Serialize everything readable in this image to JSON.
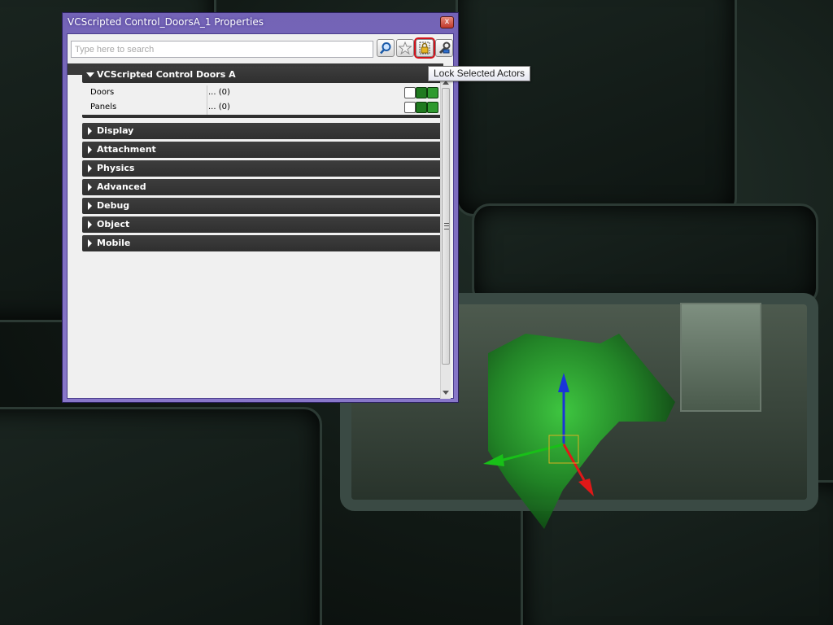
{
  "window": {
    "title": "VCScripted Control_DoorsA_1 Properties",
    "close_label": "x"
  },
  "toolbar": {
    "search_placeholder": "Type here to search",
    "buttons": [
      {
        "name": "search-button",
        "icon": "magnifier-icon"
      },
      {
        "name": "favorites-button",
        "icon": "star-icon"
      },
      {
        "name": "lock-selected-actors-button",
        "icon": "lock-icon",
        "highlighted": true
      },
      {
        "name": "tools-button",
        "icon": "wrench-icon"
      }
    ]
  },
  "tooltip": "Lock Selected Actors",
  "expanded_category": {
    "label": "VCScripted Control Doors A",
    "properties": [
      {
        "name": "Doors",
        "value": "... (0)"
      },
      {
        "name": "Panels",
        "value": "... (0)"
      }
    ]
  },
  "categories": [
    {
      "label": "Display"
    },
    {
      "label": "Attachment"
    },
    {
      "label": "Physics"
    },
    {
      "label": "Advanced"
    },
    {
      "label": "Debug"
    },
    {
      "label": "Object"
    },
    {
      "label": "Mobile"
    }
  ],
  "colors": {
    "title_bar": "#7a69bd",
    "category_bg": "#353535",
    "highlight_outline": "#d0141c",
    "gizmo_x": "#e01818",
    "gizmo_y": "#18c018",
    "gizmo_z": "#1a35d8"
  }
}
